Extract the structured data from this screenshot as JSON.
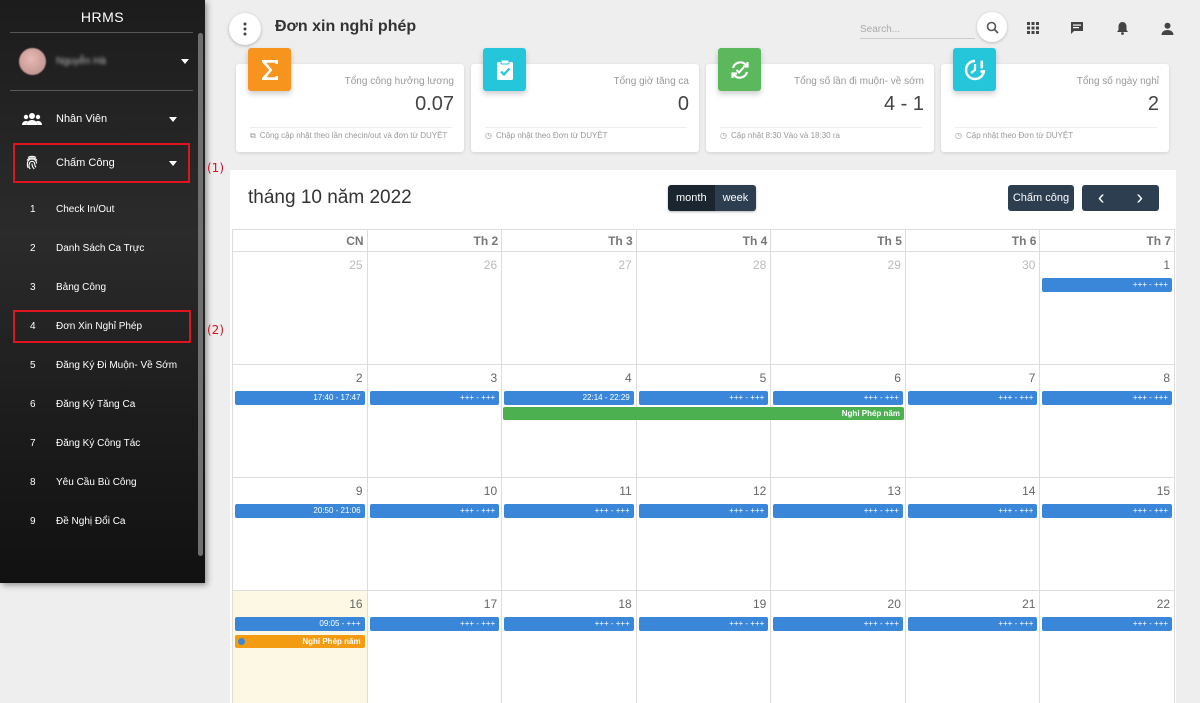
{
  "sidebar": {
    "brand": "HRMS",
    "user_name": "Nguyễn Hà",
    "groups": [
      {
        "label": "Nhân Viên",
        "icon": "users-icon"
      },
      {
        "label": "Chấm Công",
        "icon": "fingerprint-icon"
      }
    ],
    "items": [
      {
        "num": "1",
        "label": "Check In/Out"
      },
      {
        "num": "2",
        "label": "Danh Sách Ca Trực"
      },
      {
        "num": "3",
        "label": "Bảng Công"
      },
      {
        "num": "4",
        "label": "Đơn Xin Nghỉ Phép"
      },
      {
        "num": "5",
        "label": "Đăng Ký Đi Muộn- Về Sớm"
      },
      {
        "num": "6",
        "label": "Đăng Ký Tăng Ca"
      },
      {
        "num": "7",
        "label": "Đăng Ký Công Tác"
      },
      {
        "num": "8",
        "label": "Yêu Cầu Bù Công"
      },
      {
        "num": "9",
        "label": "Đề Nghị Đổi Ca"
      }
    ]
  },
  "callouts": {
    "one": "(1)",
    "two": "(2)"
  },
  "header": {
    "title": "Đơn xin nghỉ phép",
    "search_placeholder": "Search..."
  },
  "cards": [
    {
      "title": "Tổng công hưởng lương",
      "value": "0.07",
      "footer": "Công cập nhật theo lần checin/out và đơn từ DUYỆT",
      "color": "#f7941d",
      "icon": "sigma-icon"
    },
    {
      "title": "Tổng giờ tăng ca",
      "value": "0",
      "footer": "Chập nhật theo Đơn từ DUYỆT",
      "color": "#26c6da",
      "icon": "checklist-icon"
    },
    {
      "title": "Tổng số lần đi muộn- về sớm",
      "value": "4 - 1",
      "footer": "Cập nhật 8:30 Vào và 18:30 ra",
      "color": "#5cb85c",
      "icon": "sync-icon"
    },
    {
      "title": "Tổng số ngày nghỉ",
      "value": "2",
      "footer": "Cập nhật theo Đơn từ DUYỆT",
      "color": "#26c6da",
      "icon": "timer-alert-icon"
    }
  ],
  "calendar": {
    "title": "tháng 10 năm 2022",
    "view_month": "month",
    "view_week": "week",
    "cham_cong_label": "Chấm công",
    "prev": "‹",
    "next": "›",
    "dow": [
      "CN",
      "Th 2",
      "Th 3",
      "Th 4",
      "Th 5",
      "Th 6",
      "Th 7"
    ],
    "weeks": [
      [
        {
          "n": "25",
          "other": true
        },
        {
          "n": "26",
          "other": true
        },
        {
          "n": "27",
          "other": true
        },
        {
          "n": "28",
          "other": true
        },
        {
          "n": "29",
          "other": true
        },
        {
          "n": "30",
          "other": true
        },
        {
          "n": "1",
          "ev": "+++ - +++"
        }
      ],
      [
        {
          "n": "2",
          "ev": "17:40 - 17:47"
        },
        {
          "n": "3",
          "ev": "+++ - +++"
        },
        {
          "n": "4",
          "ev": "22:14 - 22:29"
        },
        {
          "n": "5",
          "ev": "+++ - +++"
        },
        {
          "n": "6",
          "ev": "+++ - +++"
        },
        {
          "n": "7",
          "ev": "+++ - +++"
        },
        {
          "n": "8",
          "ev": "+++ - +++"
        }
      ],
      [
        {
          "n": "9",
          "ev": "20:50 - 21:06"
        },
        {
          "n": "10",
          "ev": "+++ - +++"
        },
        {
          "n": "11",
          "ev": "+++ - +++"
        },
        {
          "n": "12",
          "ev": "+++ - +++"
        },
        {
          "n": "13",
          "ev": "+++ - +++"
        },
        {
          "n": "14",
          "ev": "+++ - +++"
        },
        {
          "n": "15",
          "ev": "+++ - +++"
        }
      ],
      [
        {
          "n": "16",
          "ev": "09:05 - +++",
          "today": true
        },
        {
          "n": "17",
          "ev": "+++ - +++"
        },
        {
          "n": "18",
          "ev": "+++ - +++"
        },
        {
          "n": "19",
          "ev": "+++ - +++"
        },
        {
          "n": "20",
          "ev": "+++ - +++"
        },
        {
          "n": "21",
          "ev": "+++ - +++"
        },
        {
          "n": "22",
          "ev": "+++ - +++"
        }
      ]
    ],
    "leave_events": [
      {
        "label": "Nghỉ Phép năm",
        "color": "#4caf50"
      },
      {
        "label": "Nghỉ Phép năm",
        "color": "#f39c12"
      }
    ]
  }
}
